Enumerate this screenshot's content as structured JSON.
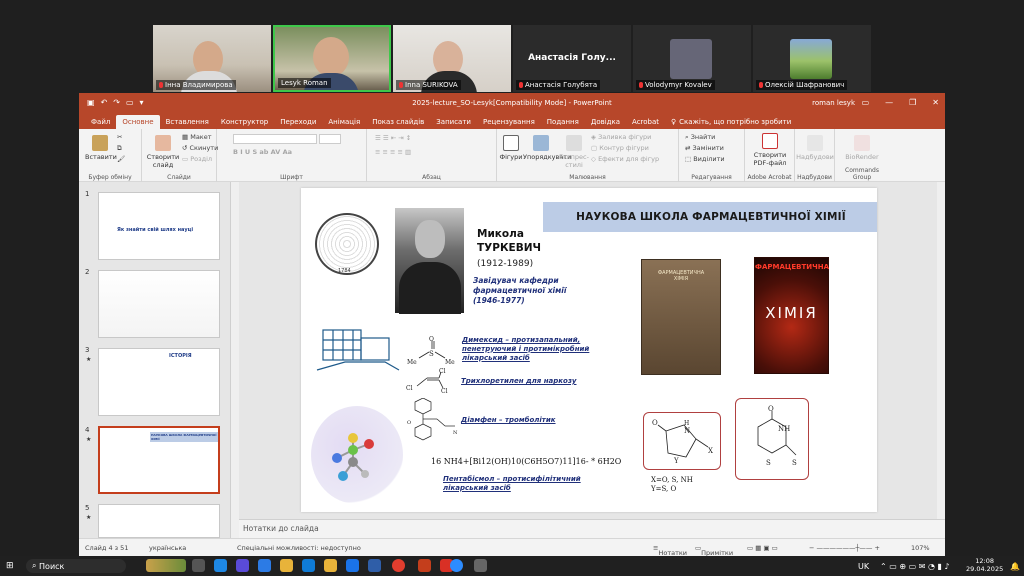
{
  "zoom": {
    "participants": [
      {
        "name": "Інна Владимирова"
      },
      {
        "name": "Lesyk Roman"
      },
      {
        "name": "Inna SURIKOVA"
      },
      {
        "name": "Анастасія Голу...",
        "label": "Анастасія Голубята"
      },
      {
        "name": "Volodymyr Kovalev"
      },
      {
        "name": "Олексій Шафранович"
      }
    ]
  },
  "ppt": {
    "title": "2025-lecture_SO-Lesyk[Compatibility Mode] - PowerPoint",
    "user": "roman lesyk",
    "tabs": [
      "Файл",
      "Основне",
      "Вставлення",
      "Конструктор",
      "Переходи",
      "Анімація",
      "Показ слайдів",
      "Записати",
      "Рецензування",
      "Подання",
      "Довідка",
      "Acrobat"
    ],
    "tell_me": "Скажіть, що потрібно зробити",
    "ribbon": {
      "paste": "Вставити",
      "clipboard": "Буфер обміну",
      "new_slide": "Створити слайд",
      "layout": "Макет",
      "reset": "Скинути",
      "section": "Розділ",
      "slides": "Слайди",
      "font": "Шрифт",
      "paragraph": "Абзац",
      "shapes": "Фігури",
      "arrange": "Упорядкувати",
      "quick_styles": "Експрес-стилі",
      "shape_fill": "Заливка фігури",
      "shape_outline": "Контур фігури",
      "shape_effects": "Ефекти для фігур",
      "drawing": "Малювання",
      "find": "Знайти",
      "replace": "Замінити",
      "select": "Виділити",
      "editing": "Редагування",
      "create_pdf": "Створити PDF-файл",
      "adobe": "Adobe Acrobat",
      "nadbudovy": "Надбудови",
      "nadbudovy_grp": "Надбудови",
      "biorender": "BioRender",
      "commands": "Commands Group"
    },
    "thumbnails": [
      {
        "num": "1",
        "caption": "Як знайти свій шлях науці"
      },
      {
        "num": "2",
        "caption": ""
      },
      {
        "num": "3",
        "caption": "ІСТОРІЯ"
      },
      {
        "num": "4",
        "caption": "НАУКОВА ШКОЛА ФАРМАЦЕВТИЧНОЇ ХІМІЇ"
      },
      {
        "num": "5",
        "caption": ""
      }
    ],
    "slide": {
      "banner": "НАУКОВА ШКОЛА ФАРМАЦЕВТИЧНОЇ ХІМІЇ",
      "name_first": "Микола",
      "name_last": "ТУРКЕВИЧ",
      "years": "(1912-1989)",
      "role": "Завідувач кафедри фармацевтичної хімії (1946-1977)",
      "seal_year": "1784",
      "note_dimexide": "Димексид – протизапальний, пенетруючий і протимікробний лікарський засіб",
      "note_trichlor": "Трихлоретилен для наркозу",
      "note_diamifen": "Діамфен – тромболітик",
      "formula": "16 NH4+[Bi12(OH)10(C6H5O7)11]16- * 6H2O",
      "note_pentabismol": "Пентабісмол – протисифілітичний лікарський засіб",
      "book1_title": "ФАРМАЦЕВТИЧНА ХІМІЯ",
      "book2_title_top": "ФАРМАЦЕВТИЧНА",
      "book2_title_big": "ХІМІЯ",
      "ring1_legend": "X=O, S, NH",
      "ring1_legend2": "Y=S, O",
      "ring_labels": {
        "o": "O",
        "nh": "NH",
        "h": "H",
        "n": "N",
        "y": "Y",
        "x": "X",
        "s": "S"
      }
    },
    "notes_placeholder": "Нотатки до слайда",
    "status": {
      "slide_count": "Слайд 4 з 51",
      "language": "українська",
      "accessibility": "Спеціальні можливості: недоступно",
      "notes": "Нотатки",
      "comments": "Примітки",
      "zoom": "107%"
    }
  },
  "taskbar": {
    "search": "Поиск",
    "lang": "UK",
    "time": "12:08",
    "date": "29.04.2025"
  },
  "colors": {
    "ppt_accent": "#b7472a",
    "slide_blue_text": "#20307a",
    "banner_bg": "#bccce6"
  }
}
